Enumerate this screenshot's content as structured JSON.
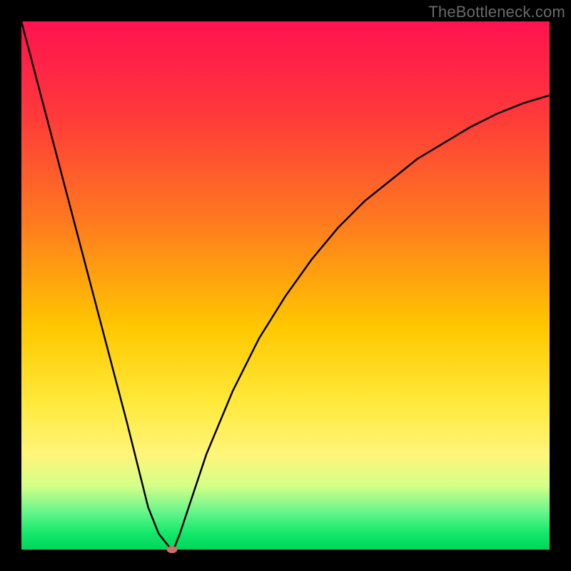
{
  "watermark": {
    "text": "TheBottleneck.com"
  },
  "chart_data": {
    "type": "line",
    "title": "",
    "xlabel": "",
    "ylabel": "",
    "xlim": [
      0,
      100
    ],
    "ylim": [
      0,
      100
    ],
    "series": [
      {
        "name": "bottleneck-curve",
        "x": [
          0,
          5,
          10,
          15,
          20,
          24,
          26,
          28,
          28.5,
          29,
          30,
          32,
          35,
          40,
          45,
          50,
          55,
          60,
          65,
          70,
          75,
          80,
          85,
          90,
          95,
          100
        ],
        "values": [
          100,
          81,
          62,
          43,
          24,
          8,
          3,
          0.5,
          0,
          0.5,
          3,
          9,
          18,
          30,
          40,
          48,
          55,
          61,
          66,
          70,
          74,
          77,
          80,
          82.5,
          84.5,
          86
        ]
      }
    ],
    "marker": {
      "x": 28.5,
      "y": 0
    },
    "background": "red-yellow-green-gradient"
  }
}
